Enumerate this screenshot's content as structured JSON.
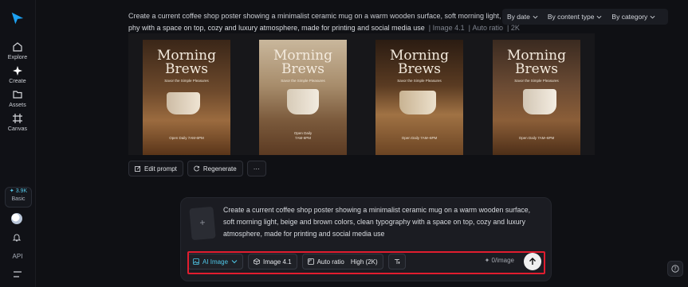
{
  "sidebar": {
    "items": [
      {
        "label": "Explore",
        "icon": "home-icon"
      },
      {
        "label": "Create",
        "icon": "sparkle-icon"
      },
      {
        "label": "Assets",
        "icon": "folder-icon"
      },
      {
        "label": "Canvas",
        "icon": "canvas-icon"
      }
    ],
    "credits": "3.9K",
    "plan": "Basic",
    "api": "API"
  },
  "filters": [
    "By date",
    "By content type",
    "By category"
  ],
  "prompt": {
    "line1": "Create a current coffee shop poster showing a minimalist ceramic mug on a warm wooden surface, soft morning light, beige ar",
    "line2": "phy with a space on top, cozy and luxury atmosphere, made for printing and social media use",
    "model": "Image 4.1",
    "ratio": "Auto ratio",
    "quality": "2K"
  },
  "posters": [
    {
      "title": "Morning\nBrews",
      "subtitle": "Savor the Simple Pleasures",
      "footer": "Open Daily 7AM-6PM"
    },
    {
      "title": "Morning\nBrews",
      "subtitle": "Savor the Simple Pleasures",
      "footer": "Open Daily\n7AM-6PM"
    },
    {
      "title": "Morning\nBrews",
      "subtitle": "Savor the Simple Pleasures",
      "footer": "Open Daily 7AM–6PM"
    },
    {
      "title": "Morning\nBrews",
      "subtitle": "Savor the Simple Pleasures",
      "footer": "Open Daily 7AM–6PM"
    }
  ],
  "actions": {
    "edit": "Edit prompt",
    "regenerate": "Regenerate",
    "more": "···"
  },
  "composer": {
    "text": "Create a current coffee shop poster showing a minimalist ceramic mug on a warm wooden surface, soft morning light, beige and brown colors, clean typography with a space on top, cozy and luxury atmosphere, made for printing and social media use",
    "mode": "AI Image",
    "model": "Image 4.1",
    "ratio": "Auto ratio",
    "quality": "High (2K)",
    "cost": "0/image"
  }
}
